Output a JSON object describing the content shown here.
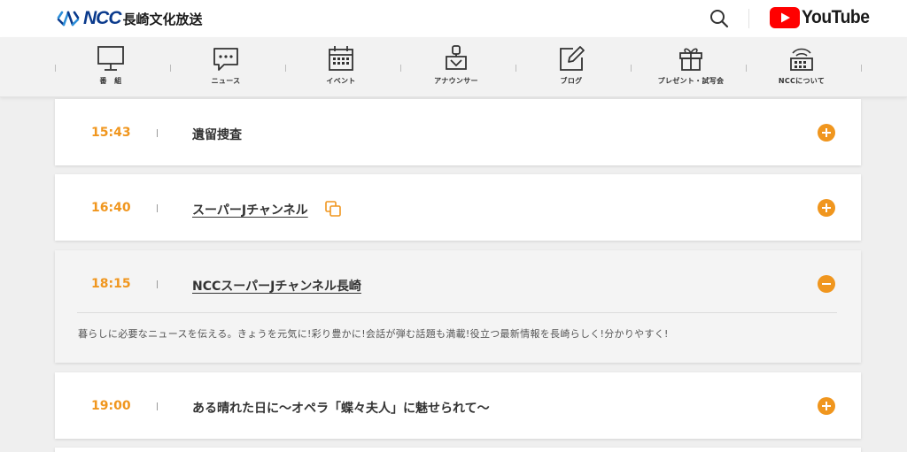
{
  "header": {
    "logo_ncc": "NCC",
    "logo_name": "長崎文化放送",
    "youtube_label": "YouTube",
    "brand_color": "#0a3a8c",
    "accent_color": "#f0961e",
    "search_icon": "search-icon"
  },
  "nav": {
    "items": [
      {
        "label": "番　組",
        "icon": "tv-monitor-icon"
      },
      {
        "label": "ニュース",
        "icon": "speech-bubble-icon"
      },
      {
        "label": "イベント",
        "icon": "calendar-icon"
      },
      {
        "label": "アナウンサー",
        "icon": "announcer-podium-icon"
      },
      {
        "label": "ブログ",
        "icon": "pen-notepad-icon"
      },
      {
        "label": "プレゼント・試写会",
        "icon": "gift-box-icon"
      },
      {
        "label": "NCCについて",
        "icon": "building-icon"
      }
    ]
  },
  "schedule": [
    {
      "time": "15:43",
      "title": "遺留捜査",
      "linked": false,
      "expanded": false
    },
    {
      "time": "16:40",
      "title": "スーパーJチャンネル",
      "linked": true,
      "external": true,
      "expanded": false
    },
    {
      "time": "18:15",
      "title": "NCCスーパーJチャンネル長崎",
      "linked": true,
      "expanded": true,
      "description": "暮らしに必要なニュースを伝える。きょうを元気に!彩り豊かに!会話が弾む話題も満載!役立つ最新情報を長崎らしく!分かりやすく!"
    },
    {
      "time": "19:00",
      "title": "ある晴れた日に～オペラ「蝶々夫人」に魅せられて～",
      "linked": false,
      "expanded": false
    }
  ]
}
